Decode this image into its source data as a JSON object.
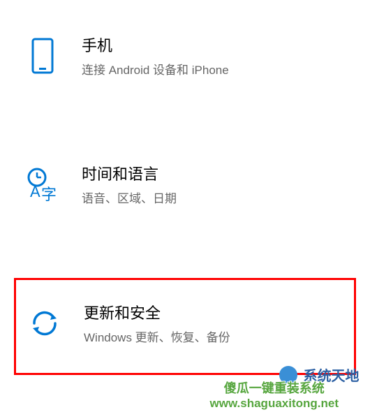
{
  "items": [
    {
      "title": "手机",
      "subtitle": "连接 Android 设备和 iPhone",
      "icon": "phone-icon",
      "highlighted": false
    },
    {
      "title": "时间和语言",
      "subtitle": "语音、区域、日期",
      "icon": "time-language-icon",
      "highlighted": false
    },
    {
      "title": "更新和安全",
      "subtitle": "Windows 更新、恢复、备份",
      "icon": "sync-icon",
      "highlighted": true
    }
  ],
  "watermark": {
    "line1": "傻瓜一键重装系统",
    "line2": "www.shaguaxitong.net",
    "badge": "系统天地"
  },
  "colors": {
    "iconBlue": "#0078d4",
    "highlightBorder": "#ff0000",
    "watermarkGreen": "#57a63f"
  }
}
